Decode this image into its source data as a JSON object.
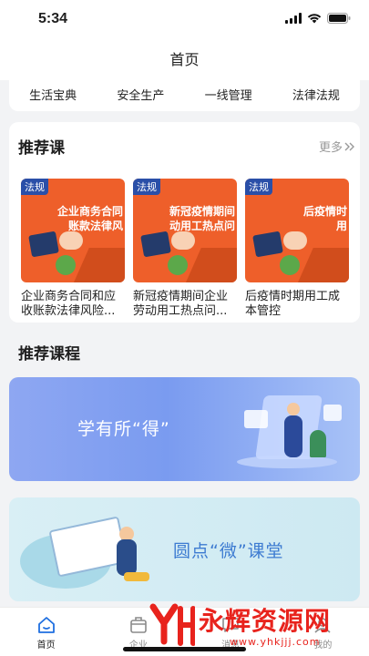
{
  "status_bar": {
    "time": "5:34"
  },
  "nav": {
    "title": "首页"
  },
  "categories": [
    {
      "label": "生活宝典"
    },
    {
      "label": "安全生产"
    },
    {
      "label": "一线管理"
    },
    {
      "label": "法律法规"
    }
  ],
  "recommend": {
    "title": "推荐课",
    "more_label": "更多",
    "items": [
      {
        "tag": "法规",
        "thumb_text": "企业商务合同\n账款法律风",
        "name": "企业商务合同和应收账款法律风险..."
      },
      {
        "tag": "法规",
        "thumb_text": "新冠疫情期间\n动用工热点问",
        "name": "新冠疫情期间企业劳动用工热点问..."
      },
      {
        "tag": "法规",
        "thumb_text": "后疫情时\n用",
        "name": "后疫情时期用工成本管控"
      }
    ]
  },
  "courses": {
    "title": "推荐课程",
    "banners": [
      {
        "text": "学有所“得”"
      },
      {
        "text": "圆点“微”课堂"
      }
    ]
  },
  "tabs": [
    {
      "label": "首页",
      "icon": "home-icon",
      "active": true
    },
    {
      "label": "企业",
      "icon": "enterprise-icon",
      "active": false
    },
    {
      "label": "消息",
      "icon": "message-icon",
      "active": false
    },
    {
      "label": "我的",
      "icon": "profile-icon",
      "active": false
    }
  ],
  "watermark": {
    "text": "永辉资源网",
    "url": "www.yhkjjj.com"
  },
  "colors": {
    "accent_orange": "#ee5f2a",
    "watermark_red": "#e8231d",
    "banner_blue": "#7a9bf0"
  }
}
